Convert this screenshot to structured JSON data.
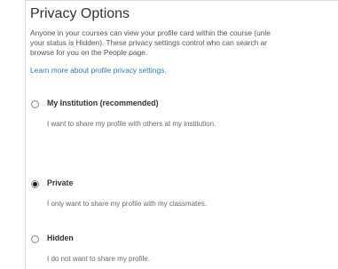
{
  "panel": {
    "title": "Privacy Options",
    "description_lines": [
      "Anyone in your courses can view your profile card within the course (unle",
      "your status is Hidden). These privacy settings control who can search ar",
      "browse for you on the People page."
    ],
    "learn_more_link": "Learn more about profile privacy settings."
  },
  "options": [
    {
      "label": "My Institution (recommended)",
      "help": "I want to share my profile with others at my institution.",
      "selected": false
    },
    {
      "label": "Private",
      "help": "I only want to share my profile with my classmates.",
      "selected": true
    },
    {
      "label": "Hidden",
      "help": "I do not want to share my profile.",
      "selected": false
    }
  ]
}
